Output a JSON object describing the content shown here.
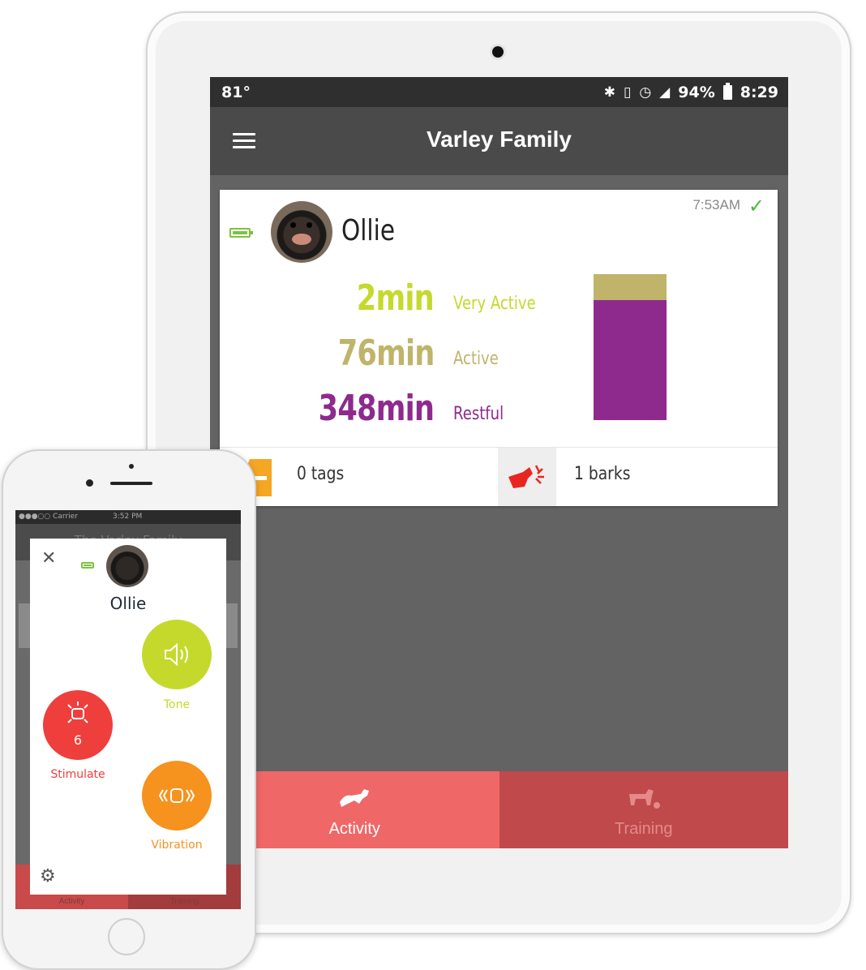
{
  "tablet": {
    "status": {
      "temperature": "81°",
      "battery_percent": "94%",
      "time": "8:29",
      "icons": [
        "bluetooth-icon",
        "vibrate-icon",
        "alarm-icon",
        "wifi-icon",
        "signal-icon",
        "battery-icon"
      ]
    },
    "appbar": {
      "title": "Varley Family"
    },
    "card": {
      "time": "7:53AM",
      "pet_name": "Ollie",
      "metrics": [
        {
          "value": "2min",
          "label": "Very Active",
          "color": "#c5d92d"
        },
        {
          "value": "76min",
          "label": "Active",
          "color": "#bfb46a"
        },
        {
          "value": "348min",
          "label": "Restful",
          "color": "#8e2a8e"
        }
      ],
      "activity_bar": {
        "very_active_min": 2,
        "active_min": 76,
        "restful_min": 348,
        "active_color": "#bfb46a",
        "restful_color": "#8e2a8e"
      },
      "tags_label": "0 tags",
      "barks_label": "1 barks"
    },
    "tabs": [
      {
        "label": "Activity",
        "icon": "running-dog-icon"
      },
      {
        "label": "Training",
        "icon": "sitting-dog-icon"
      }
    ]
  },
  "phone": {
    "status": {
      "carrier": "●●●○○ Carrier",
      "time": "3:52 PM"
    },
    "header_title": "The Varley Family",
    "tabs": [
      "Activity",
      "Training"
    ],
    "modal": {
      "pet_name": "Ollie",
      "tone_label": "Tone",
      "stimulate_label": "Stimulate",
      "stimulate_level": "6",
      "vibration_label": "Vibration"
    }
  }
}
